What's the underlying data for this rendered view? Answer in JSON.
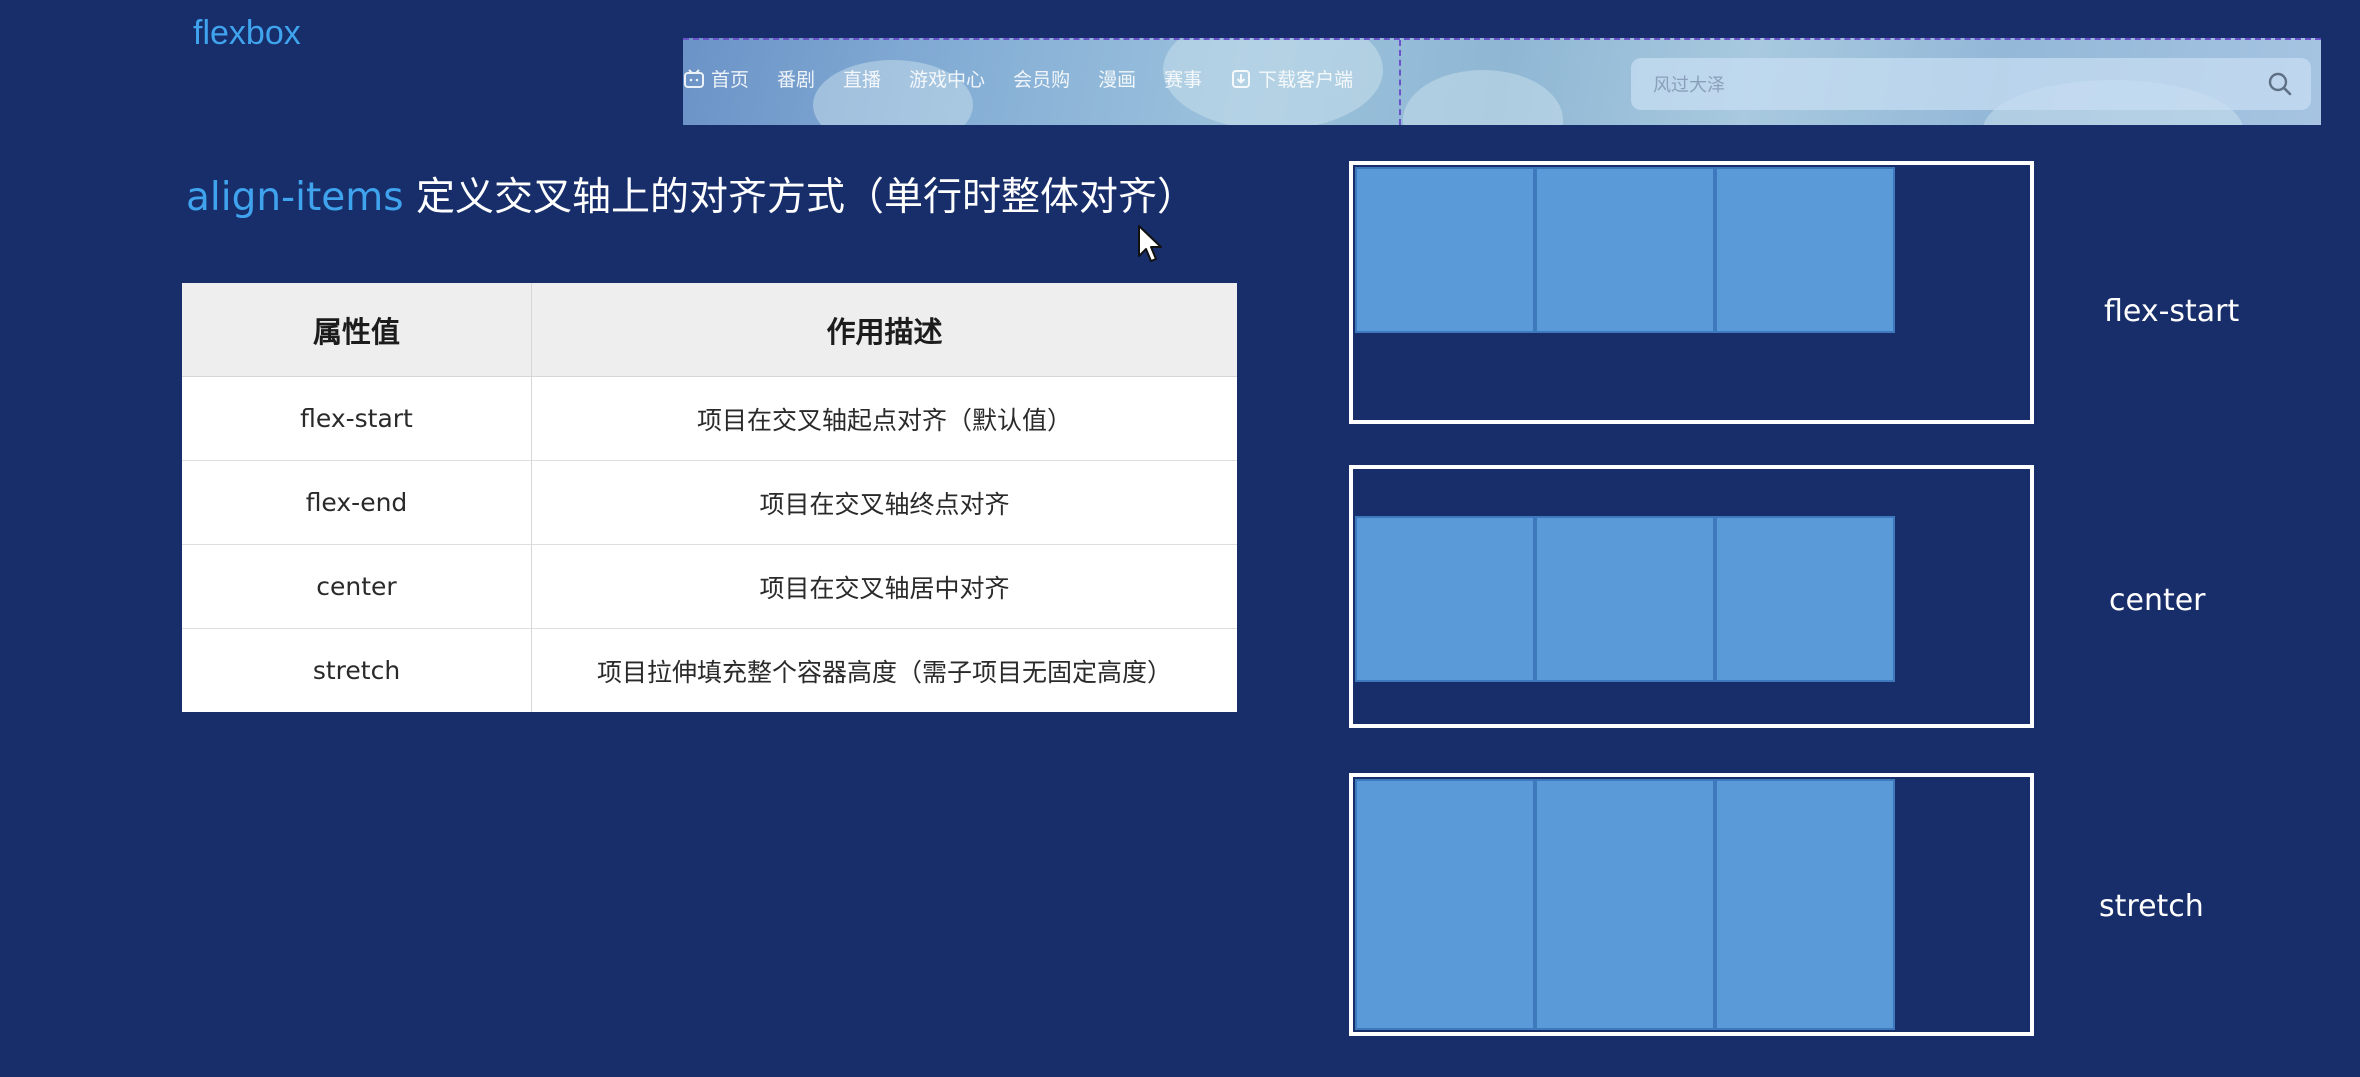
{
  "top_title": "flexbox",
  "embed_nav": {
    "items": [
      {
        "label": "首页",
        "icon": "bilibili-tv-icon"
      },
      {
        "label": "番剧"
      },
      {
        "label": "直播"
      },
      {
        "label": "游戏中心"
      },
      {
        "label": "会员购"
      },
      {
        "label": "漫画"
      },
      {
        "label": "赛事"
      },
      {
        "label": "下载客户端",
        "icon": "download-icon"
      }
    ],
    "search_placeholder": "风过大泽",
    "search_icon": "search-icon"
  },
  "heading": {
    "keyword": "align-items",
    "text": " 定义交叉轴上的对齐方式（单行时整体对齐）"
  },
  "table": {
    "headers": [
      "属性值",
      "作用描述"
    ],
    "rows": [
      {
        "value": "flex-start",
        "desc": "项目在交叉轴起点对齐（默认值）"
      },
      {
        "value": "flex-end",
        "desc": "项目在交叉轴终点对齐"
      },
      {
        "value": "center",
        "desc": "项目在交叉轴居中对齐"
      },
      {
        "value": "stretch",
        "desc": "项目拉伸填充整个容器高度（需子项目无固定高度）"
      }
    ]
  },
  "demos": [
    {
      "label": "flex-start"
    },
    {
      "label": "center"
    },
    {
      "label": "stretch"
    }
  ],
  "colors": {
    "background": "#172e6a",
    "accent": "#3fa3ee",
    "demo_item": "#5a9ad8",
    "demo_item_border": "#3e79bd"
  }
}
